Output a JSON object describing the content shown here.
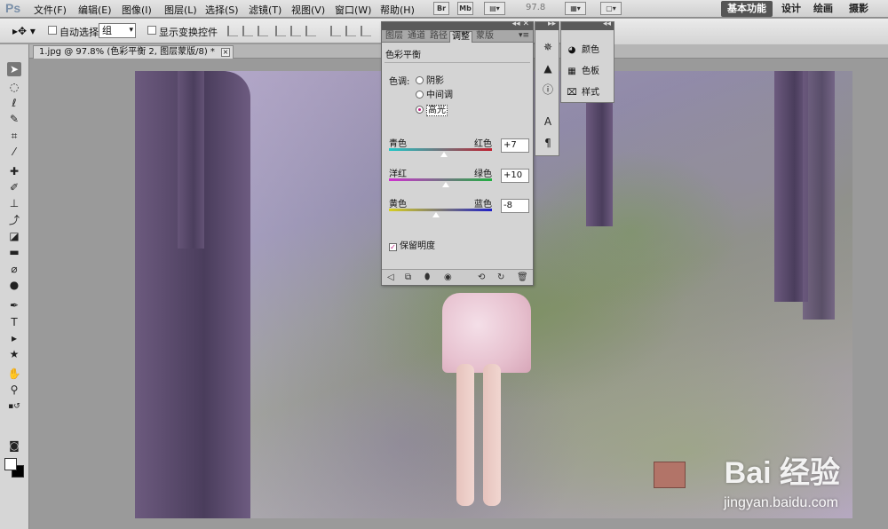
{
  "app": {
    "logo": "Ps",
    "menu": [
      "文件(F)",
      "编辑(E)",
      "图像(I)",
      "图层(L)",
      "选择(S)",
      "滤镜(T)",
      "视图(V)",
      "窗口(W)",
      "帮助(H)"
    ],
    "bridge_btn": "Br",
    "minibridge_btn": "Mb",
    "zoom": "97.8",
    "workspaces": [
      "基本功能",
      "设计",
      "绘画",
      "摄影"
    ]
  },
  "options": {
    "auto_select_label": "自动选择:",
    "auto_select_value": "组",
    "show_transform_label": "显示变换控件"
  },
  "document": {
    "tab_title": "1.jpg @ 97.8% (色彩平衡 2, 图层蒙版/8) *",
    "close": "×"
  },
  "adjustments": {
    "tabs": [
      "图层",
      "通道",
      "路径",
      "调整",
      "蒙版"
    ],
    "active_tab": "调整",
    "title": "色彩平衡",
    "tone_label": "色调:",
    "tones": [
      "阴影",
      "中间调",
      "高光"
    ],
    "selected_tone": "高光",
    "sliders": [
      {
        "left": "青色",
        "right": "红色",
        "value": "+7",
        "fraction": 0.535
      },
      {
        "left": "洋红",
        "right": "绿色",
        "value": "+10",
        "fraction": 0.55
      },
      {
        "left": "黄色",
        "right": "蓝色",
        "value": "-8",
        "fraction": 0.46
      }
    ],
    "preserve_label": "保留明度",
    "preserve_checked": "✓"
  },
  "panels": {
    "color": "颜色",
    "swatches": "色板",
    "styles": "样式"
  },
  "watermark": {
    "brand": "Bai 经验",
    "url": "jingyan.baidu.com"
  }
}
